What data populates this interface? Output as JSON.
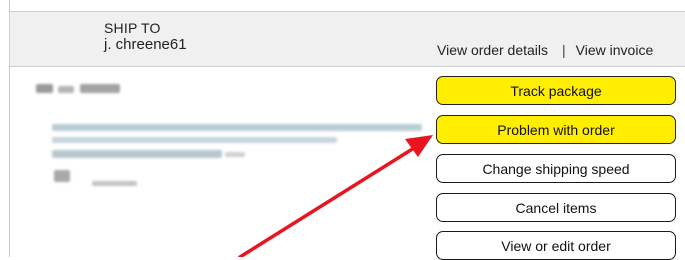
{
  "shipment": {
    "ship_to_label": "SHIP TO",
    "ship_to_name": "j. chreene61"
  },
  "order_links": {
    "details": "View order details",
    "separator": "|",
    "invoice": "View invoice"
  },
  "actions": [
    {
      "label": "Track package",
      "style": "primary"
    },
    {
      "label": "Problem with order",
      "style": "primary"
    },
    {
      "label": "Change shipping speed",
      "style": "secondary"
    },
    {
      "label": "Cancel items",
      "style": "secondary"
    },
    {
      "label": "View or edit order",
      "style": "secondary"
    }
  ],
  "colors": {
    "primary_button": "#ffee00",
    "annotation_arrow": "#e8141f"
  }
}
